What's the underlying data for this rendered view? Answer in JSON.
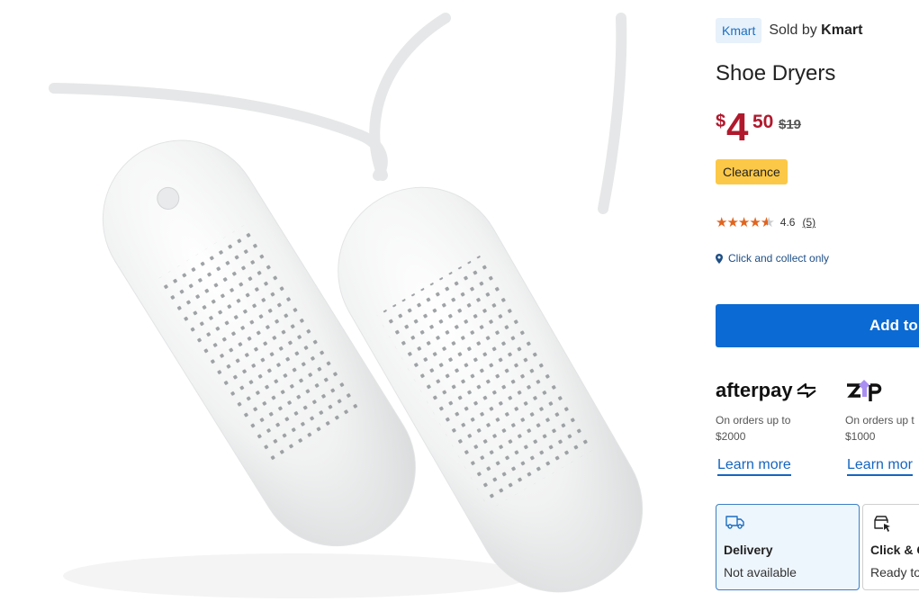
{
  "product": {
    "image_alt": "White shoe dryers product image",
    "seller_badge": "Kmart",
    "sold_by_prefix": "Sold by",
    "sold_by_name": "Kmart",
    "title": "Shoe Dryers",
    "price": {
      "currency": "$",
      "whole": "4",
      "cents": "50",
      "was": "$19",
      "color": "#b0192d"
    },
    "clearance_label": "Clearance",
    "rating": {
      "value": 4.6,
      "value_label": "4.6",
      "count_label": "(5)",
      "stars_full": 4,
      "stars_half": 1,
      "star_color": "#e0641e"
    },
    "collect_note": "Click and collect only"
  },
  "cart": {
    "add_label": "Add to",
    "accent": "#0b6ad3"
  },
  "payment": {
    "afterpay": {
      "logo": "afterpay",
      "desc_line1": "On orders up to",
      "desc_line2": "$2000",
      "learn_more": "Learn more"
    },
    "zip": {
      "logo": "zip",
      "desc_line1": "On orders up t",
      "desc_line2": "$1000",
      "learn_more": "Learn mor"
    }
  },
  "fulfilment": {
    "delivery": {
      "icon": "truck-icon",
      "title": "Delivery",
      "status": "Not available"
    },
    "click_collect": {
      "icon": "click-collect-icon",
      "title": "Click & C",
      "status": "Ready to"
    }
  }
}
